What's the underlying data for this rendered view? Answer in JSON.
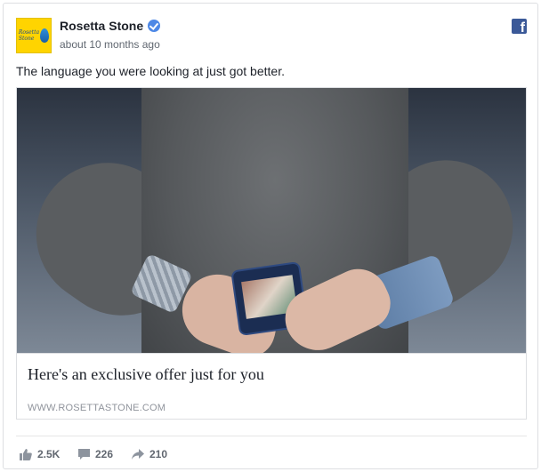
{
  "post": {
    "page_name": "Rosetta Stone",
    "timestamp": "about 10 months ago",
    "text": "The language you were looking at just got better.",
    "avatar_logo_text": "Rosetta Stone",
    "brand_icon": "facebook-icon"
  },
  "link": {
    "title": "Here's an exclusive offer just for you",
    "domain": "WWW.ROSETTASTONE.COM"
  },
  "stats": {
    "likes": "2.5K",
    "comments": "226",
    "shares": "210"
  },
  "colors": {
    "facebook_blue": "#3b5998",
    "verified_blue": "#4d88e6",
    "avatar_yellow": "#ffd400"
  }
}
